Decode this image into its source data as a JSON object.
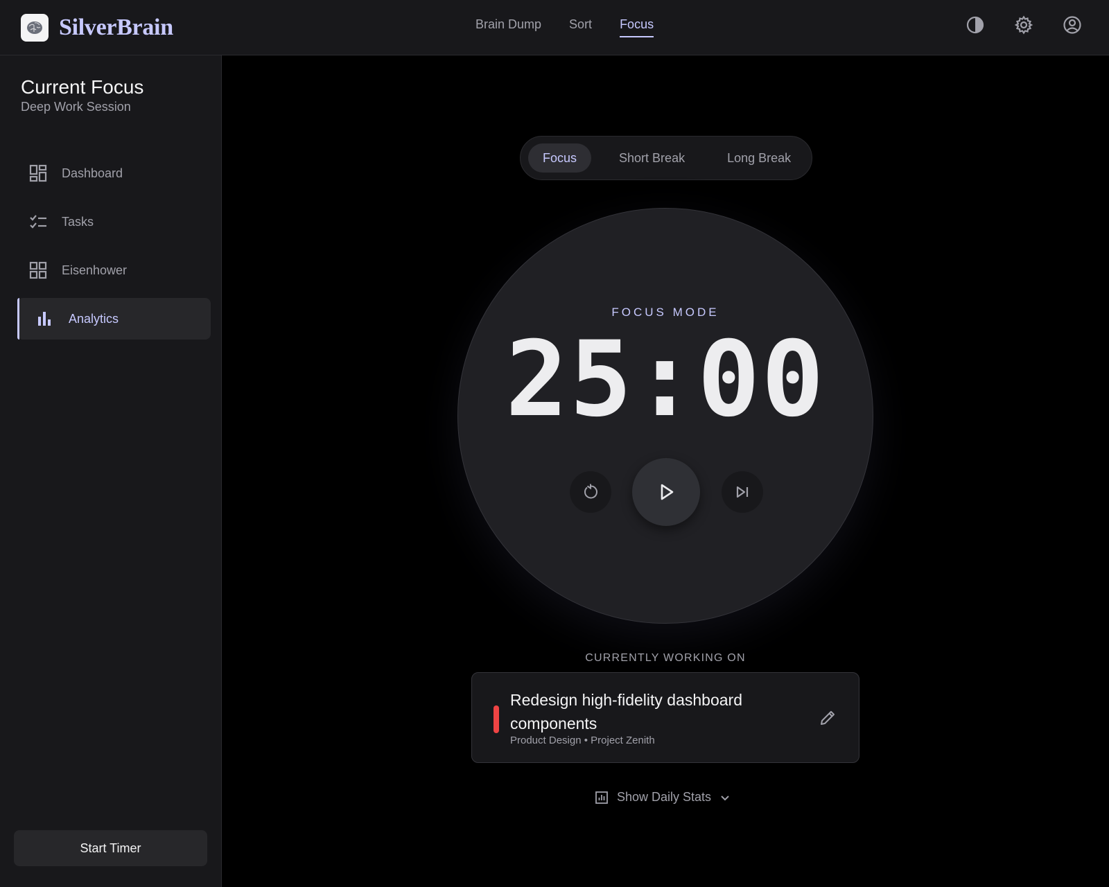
{
  "app": {
    "name": "SilverBrain"
  },
  "topnav": {
    "items": [
      {
        "label": "Brain Dump"
      },
      {
        "label": "Sort"
      },
      {
        "label": "Focus",
        "active": true
      }
    ]
  },
  "header_icons": [
    "contrast-icon",
    "gear-icon",
    "account-icon"
  ],
  "sidebar": {
    "title": "Current Focus",
    "subtitle": "Deep Work Session",
    "items": [
      {
        "label": "Dashboard",
        "icon": "dashboard-icon"
      },
      {
        "label": "Tasks",
        "icon": "checklist-icon"
      },
      {
        "label": "Eisenhower",
        "icon": "grid-icon"
      },
      {
        "label": "Analytics",
        "icon": "bar-chart-icon",
        "active": true
      }
    ],
    "button_label": "Start Timer"
  },
  "modes": {
    "items": [
      {
        "label": "Focus",
        "active": true
      },
      {
        "label": "Short Break"
      },
      {
        "label": "Long Break"
      }
    ]
  },
  "timer": {
    "mode_label": "FOCUS MODE",
    "time": "25:00"
  },
  "current_task": {
    "section_label": "CURRENTLY WORKING ON",
    "title": "Redesign high-fidelity dashboard components",
    "meta": "Product Design • Project Zenith",
    "priority_color": "#ef4444"
  },
  "stats_toggle": {
    "label": "Show Daily Stats"
  },
  "colors": {
    "accent": "#c7c9ff",
    "background": "#000000",
    "panel": "#18181b"
  }
}
